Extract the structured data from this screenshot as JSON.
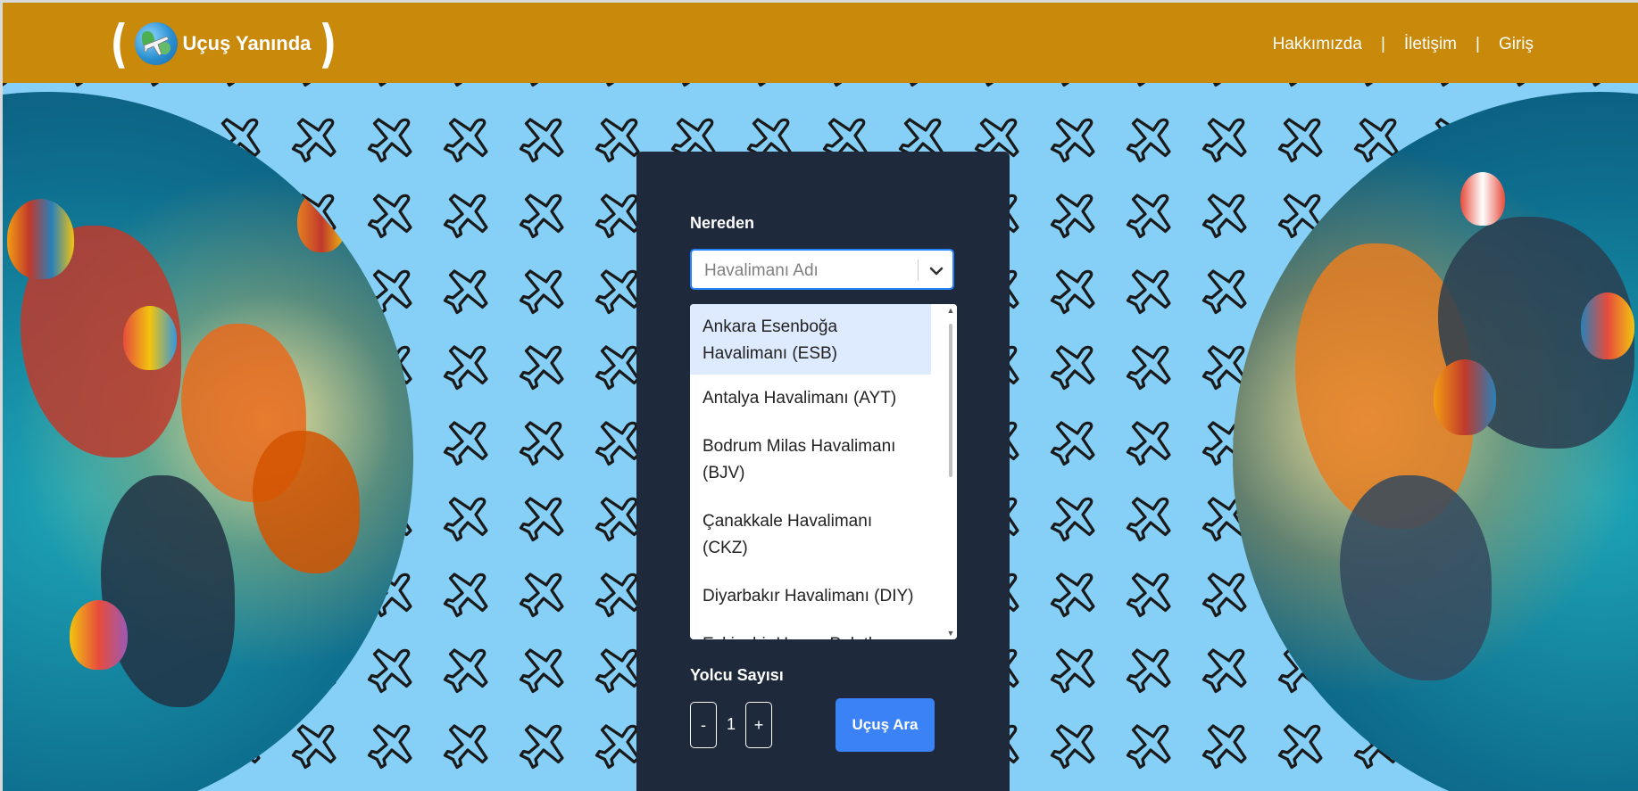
{
  "header": {
    "brand": "Uçuş Yanında",
    "nav": [
      {
        "label": "Hakkımızda"
      },
      {
        "label": "İletişim"
      },
      {
        "label": "Giriş"
      }
    ],
    "separator": "|",
    "background_color": "#c9890a"
  },
  "form": {
    "from_label": "Nereden",
    "from_placeholder": "Havalimanı Adı",
    "dropdown_options": [
      {
        "label": "Ankara Esenboğa Havalimanı (ESB)",
        "highlighted": true
      },
      {
        "label": "Antalya Havalimanı (AYT)",
        "highlighted": false
      },
      {
        "label": "Bodrum Milas Havalimanı (BJV)",
        "highlighted": false
      },
      {
        "label": "Çanakkale Havalimanı (CKZ)",
        "highlighted": false
      },
      {
        "label": "Diyarbakır Havalimanı (DIY)",
        "highlighted": false
      },
      {
        "label": "Eskişehir Hasan Polatkan Havalimanı (AOE)",
        "highlighted": false
      }
    ],
    "passenger_label": "Yolcu Sayısı",
    "minus_label": "-",
    "plus_label": "+",
    "passenger_count": "1",
    "search_button": "Uçuş Ara",
    "search_button_color": "#3b82f6",
    "panel_color": "#1e293b"
  },
  "background": {
    "color": "#86d0f8",
    "pattern_icon": "airplane-icon"
  }
}
